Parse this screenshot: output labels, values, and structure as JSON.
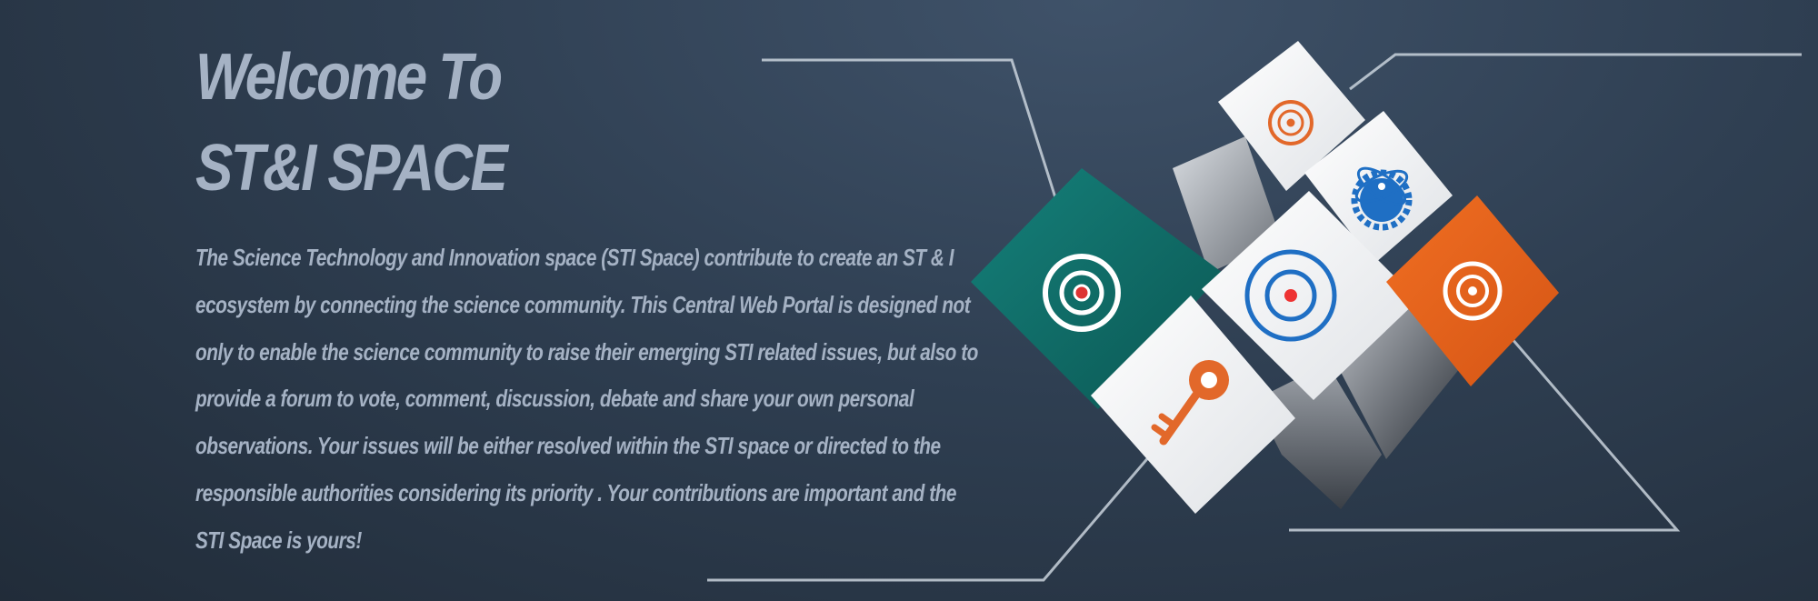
{
  "hero": {
    "title_line1": "Welcome To",
    "title_line2": "ST&I SPACE",
    "description": "The Science Technology and Innovation space (STI Space) contribute to create an ST & I ecosystem by connecting the science community. This Central Web Portal is designed not only to enable the science community to raise their emerging STI related issues, but also to provide a forum to vote, comment, discussion, debate and share your own personal observations. Your issues will be either resolved within the STI space or directed to the responsible authorities considering its priority . Your contributions are important and the STI Space is yours!"
  },
  "graphic": {
    "icons": [
      "target-icon",
      "target-icon",
      "atom-gear-icon",
      "target-icon",
      "target-icon",
      "key-icon"
    ],
    "colors": {
      "teal": "#0e6a66",
      "orange": "#e8621d",
      "blue": "#1f6fc4",
      "white": "#eef0f2",
      "text": "#a5b2c4",
      "background": "#2f3f52"
    }
  }
}
